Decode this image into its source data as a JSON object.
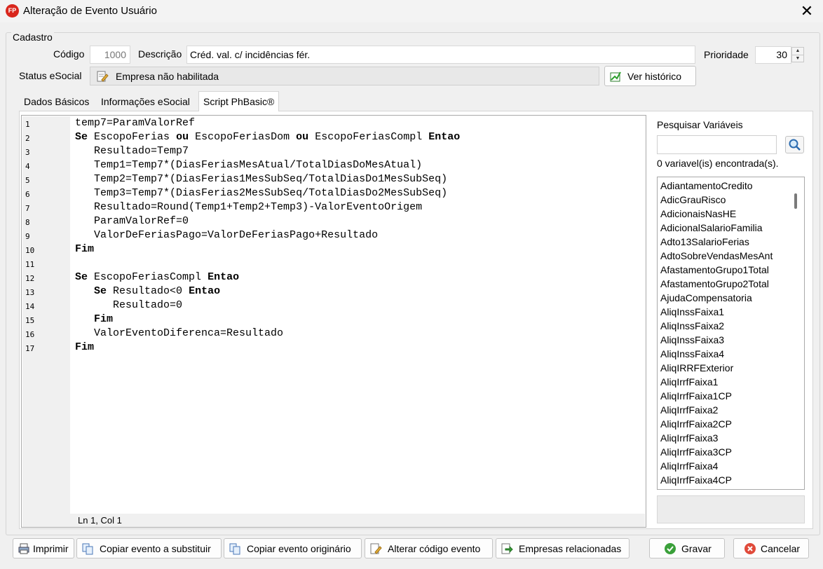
{
  "window": {
    "title": "Alteração de Evento Usuário",
    "app_icon_text": "FP",
    "close_glyph": "✕"
  },
  "cadastro": {
    "group_title": "Cadastro",
    "codigo_label": "Código",
    "codigo_value": "1000",
    "descricao_label": "Descrição",
    "descricao_value": "Créd. val. c/ incidências fér.",
    "prioridade_label": "Prioridade",
    "prioridade_value": "30",
    "status_label": "Status eSocial",
    "status_value": "Empresa não habilitada",
    "historico_button": "Ver histórico"
  },
  "tabs": [
    {
      "label": "Dados Básicos",
      "active": false
    },
    {
      "label": "Informações eSocial",
      "active": false
    },
    {
      "label": "Script PhBasic®",
      "active": true
    }
  ],
  "editor": {
    "lines": [
      "temp7=ParamValorRef",
      "Se EscopoFerias ou EscopoFeriasDom ou EscopoFeriasCompl Entao",
      "   Resultado=Temp7",
      "   Temp1=Temp7*(DiasFeriasMesAtual/TotalDiasDoMesAtual)",
      "   Temp2=Temp7*(DiasFerias1MesSubSeq/TotalDiasDo1MesSubSeq)",
      "   Temp3=Temp7*(DiasFerias2MesSubSeq/TotalDiasDo2MesSubSeq)",
      "   Resultado=Round(Temp1+Temp2+Temp3)-ValorEventoOrigem",
      "   ParamValorRef=0",
      "   ValorDeFeriasPago=ValorDeFeriasPago+Resultado",
      "Fim",
      "",
      "Se EscopoFeriasCompl Entao",
      "   Se Resultado<0 Entao",
      "      Resultado=0",
      "   Fim",
      "   ValorEventoDiferenca=Resultado",
      "Fim"
    ],
    "keywords": [
      "Se",
      "ou",
      "Entao",
      "Fim"
    ],
    "cursor_status": "Ln 1, Col 1"
  },
  "variables": {
    "title": "Pesquisar Variáveis",
    "search_value": "",
    "count_text": "0 variavel(is) encontrada(s).",
    "items": [
      "AdiantamentoCredito",
      "AdicGrauRisco",
      "AdicionaisNasHE",
      "AdicionalSalarioFamilia",
      "Adto13SalarioFerias",
      "AdtoSobreVendasMesAnt",
      "AfastamentoGrupo1Total",
      "AfastamentoGrupo2Total",
      "AjudaCompensatoria",
      "AliqInssFaixa1",
      "AliqInssFaixa2",
      "AliqInssFaixa3",
      "AliqInssFaixa4",
      "AliqIRRFExterior",
      "AliqIrrfFaixa1",
      "AliqIrrfFaixa1CP",
      "AliqIrrfFaixa2",
      "AliqIrrfFaixa2CP",
      "AliqIrrfFaixa3",
      "AliqIrrfFaixa3CP",
      "AliqIrrfFaixa4",
      "AliqIrrfFaixa4CP"
    ]
  },
  "footer": {
    "imprimir": "Imprimir",
    "copiar_substituir": "Copiar evento a substituir",
    "copiar_originario": "Copiar evento originário",
    "alterar_codigo": "Alterar código evento",
    "empresas": "Empresas relacionadas",
    "gravar": "Gravar",
    "cancelar": "Cancelar"
  }
}
